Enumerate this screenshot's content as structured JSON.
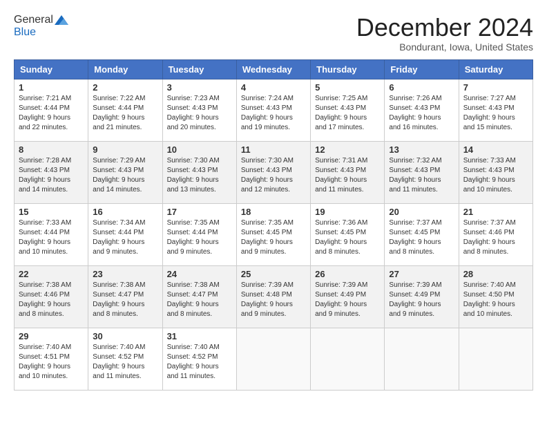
{
  "logo": {
    "general": "General",
    "blue": "Blue"
  },
  "header": {
    "month": "December 2024",
    "location": "Bondurant, Iowa, United States"
  },
  "days_of_week": [
    "Sunday",
    "Monday",
    "Tuesday",
    "Wednesday",
    "Thursday",
    "Friday",
    "Saturday"
  ],
  "weeks": [
    [
      {
        "num": "1",
        "sunrise": "7:21 AM",
        "sunset": "4:44 PM",
        "daylight": "9 hours and 22 minutes."
      },
      {
        "num": "2",
        "sunrise": "7:22 AM",
        "sunset": "4:44 PM",
        "daylight": "9 hours and 21 minutes."
      },
      {
        "num": "3",
        "sunrise": "7:23 AM",
        "sunset": "4:43 PM",
        "daylight": "9 hours and 20 minutes."
      },
      {
        "num": "4",
        "sunrise": "7:24 AM",
        "sunset": "4:43 PM",
        "daylight": "9 hours and 19 minutes."
      },
      {
        "num": "5",
        "sunrise": "7:25 AM",
        "sunset": "4:43 PM",
        "daylight": "9 hours and 17 minutes."
      },
      {
        "num": "6",
        "sunrise": "7:26 AM",
        "sunset": "4:43 PM",
        "daylight": "9 hours and 16 minutes."
      },
      {
        "num": "7",
        "sunrise": "7:27 AM",
        "sunset": "4:43 PM",
        "daylight": "9 hours and 15 minutes."
      }
    ],
    [
      {
        "num": "8",
        "sunrise": "7:28 AM",
        "sunset": "4:43 PM",
        "daylight": "9 hours and 14 minutes."
      },
      {
        "num": "9",
        "sunrise": "7:29 AM",
        "sunset": "4:43 PM",
        "daylight": "9 hours and 14 minutes."
      },
      {
        "num": "10",
        "sunrise": "7:30 AM",
        "sunset": "4:43 PM",
        "daylight": "9 hours and 13 minutes."
      },
      {
        "num": "11",
        "sunrise": "7:30 AM",
        "sunset": "4:43 PM",
        "daylight": "9 hours and 12 minutes."
      },
      {
        "num": "12",
        "sunrise": "7:31 AM",
        "sunset": "4:43 PM",
        "daylight": "9 hours and 11 minutes."
      },
      {
        "num": "13",
        "sunrise": "7:32 AM",
        "sunset": "4:43 PM",
        "daylight": "9 hours and 11 minutes."
      },
      {
        "num": "14",
        "sunrise": "7:33 AM",
        "sunset": "4:43 PM",
        "daylight": "9 hours and 10 minutes."
      }
    ],
    [
      {
        "num": "15",
        "sunrise": "7:33 AM",
        "sunset": "4:44 PM",
        "daylight": "9 hours and 10 minutes."
      },
      {
        "num": "16",
        "sunrise": "7:34 AM",
        "sunset": "4:44 PM",
        "daylight": "9 hours and 9 minutes."
      },
      {
        "num": "17",
        "sunrise": "7:35 AM",
        "sunset": "4:44 PM",
        "daylight": "9 hours and 9 minutes."
      },
      {
        "num": "18",
        "sunrise": "7:35 AM",
        "sunset": "4:45 PM",
        "daylight": "9 hours and 9 minutes."
      },
      {
        "num": "19",
        "sunrise": "7:36 AM",
        "sunset": "4:45 PM",
        "daylight": "9 hours and 8 minutes."
      },
      {
        "num": "20",
        "sunrise": "7:37 AM",
        "sunset": "4:45 PM",
        "daylight": "9 hours and 8 minutes."
      },
      {
        "num": "21",
        "sunrise": "7:37 AM",
        "sunset": "4:46 PM",
        "daylight": "9 hours and 8 minutes."
      }
    ],
    [
      {
        "num": "22",
        "sunrise": "7:38 AM",
        "sunset": "4:46 PM",
        "daylight": "9 hours and 8 minutes."
      },
      {
        "num": "23",
        "sunrise": "7:38 AM",
        "sunset": "4:47 PM",
        "daylight": "9 hours and 8 minutes."
      },
      {
        "num": "24",
        "sunrise": "7:38 AM",
        "sunset": "4:47 PM",
        "daylight": "9 hours and 8 minutes."
      },
      {
        "num": "25",
        "sunrise": "7:39 AM",
        "sunset": "4:48 PM",
        "daylight": "9 hours and 9 minutes."
      },
      {
        "num": "26",
        "sunrise": "7:39 AM",
        "sunset": "4:49 PM",
        "daylight": "9 hours and 9 minutes."
      },
      {
        "num": "27",
        "sunrise": "7:39 AM",
        "sunset": "4:49 PM",
        "daylight": "9 hours and 9 minutes."
      },
      {
        "num": "28",
        "sunrise": "7:40 AM",
        "sunset": "4:50 PM",
        "daylight": "9 hours and 10 minutes."
      }
    ],
    [
      {
        "num": "29",
        "sunrise": "7:40 AM",
        "sunset": "4:51 PM",
        "daylight": "9 hours and 10 minutes."
      },
      {
        "num": "30",
        "sunrise": "7:40 AM",
        "sunset": "4:52 PM",
        "daylight": "9 hours and 11 minutes."
      },
      {
        "num": "31",
        "sunrise": "7:40 AM",
        "sunset": "4:52 PM",
        "daylight": "9 hours and 11 minutes."
      },
      null,
      null,
      null,
      null
    ]
  ]
}
